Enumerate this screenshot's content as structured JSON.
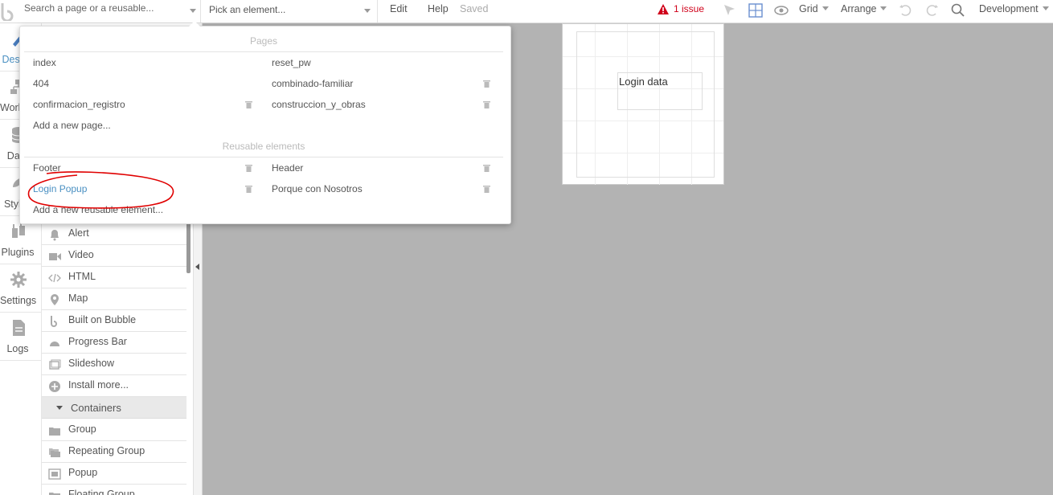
{
  "topbar": {
    "search_placeholder": "Search a page or a reusable...",
    "element_picker": "Pick an element...",
    "edit": "Edit",
    "help": "Help",
    "saved": "Saved",
    "issues": "1 issue",
    "grid": "Grid",
    "arrange": "Arrange",
    "environment": "Development"
  },
  "leftnav": {
    "items": [
      {
        "label": "Design",
        "icon": "design-icon"
      },
      {
        "label": "Workflow",
        "icon": "workflow-icon"
      },
      {
        "label": "Data",
        "icon": "data-icon"
      },
      {
        "label": "Styles",
        "icon": "styles-icon"
      },
      {
        "label": "Plugins",
        "icon": "plugins-icon"
      },
      {
        "label": "Settings",
        "icon": "gear-icon"
      },
      {
        "label": "Logs",
        "icon": "logs-icon"
      }
    ]
  },
  "elements": {
    "visual": [
      "Alert",
      "Video",
      "HTML",
      "Map",
      "Built on Bubble",
      "Progress Bar",
      "Slideshow",
      "Install more..."
    ],
    "containers_header": "Containers",
    "containers": [
      "Group",
      "Repeating Group",
      "Popup",
      "Floating Group"
    ]
  },
  "canvas": {
    "login_text": "Login data"
  },
  "dropdown": {
    "pages_header": "Pages",
    "pages_left": [
      "index",
      "404",
      "confirmacion_registro"
    ],
    "pages_right": [
      "reset_pw",
      "combinado-familiar",
      "construccion_y_obras"
    ],
    "add_page": "Add a new page...",
    "reusable_header": "Reusable elements",
    "reusable_left": [
      "Footer",
      "Login Popup"
    ],
    "reusable_right": [
      "Header",
      "Porque con Nosotros"
    ],
    "add_reusable": "Add a new reusable element...",
    "accent_color": "#4a90c2",
    "annotation_color": "#e00000"
  }
}
